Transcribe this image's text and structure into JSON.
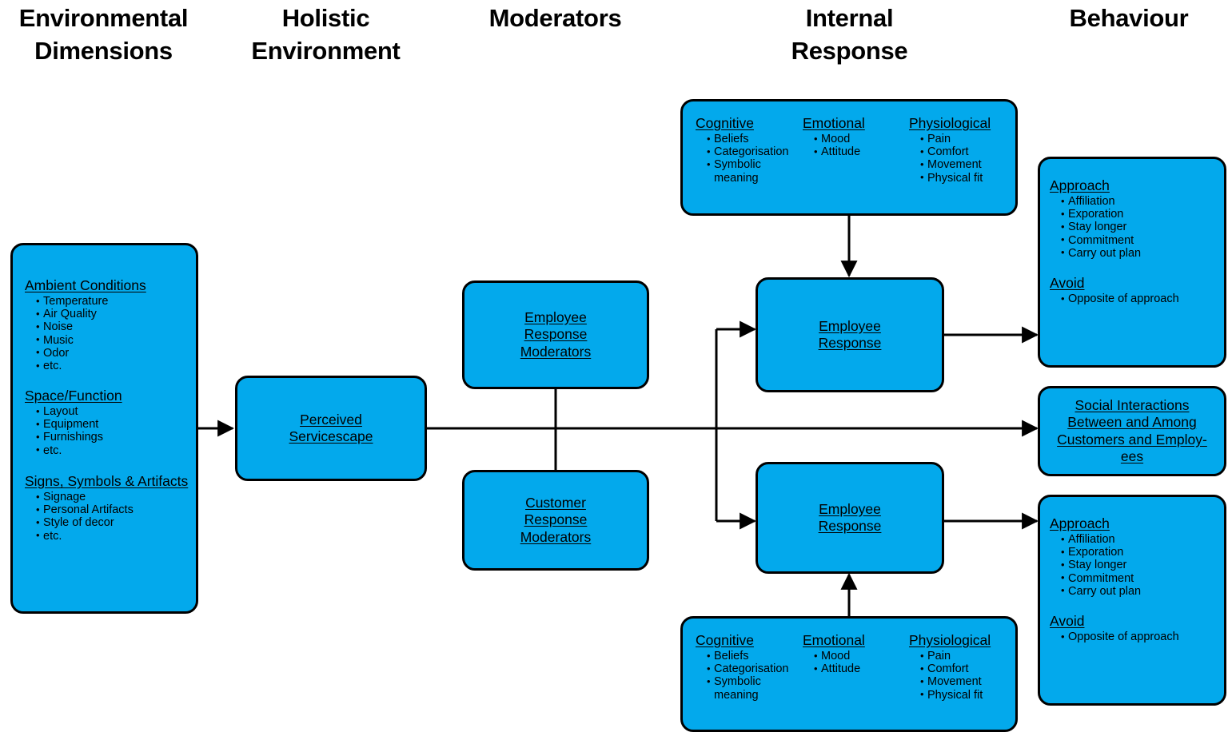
{
  "headers": [
    {
      "label": "Environmental\nDimensions"
    },
    {
      "label": "Holistic\nEnvironment"
    },
    {
      "label": "Moderators"
    },
    {
      "label": "Internal\nResponse"
    },
    {
      "label": "Behaviour"
    }
  ],
  "colors": {
    "box_fill": "#03a9ec",
    "box_stroke": "#000000",
    "text": "#000000",
    "background": "#ffffff"
  },
  "environmental_dimensions": {
    "groups": [
      {
        "title": "Ambient Conditions",
        "items": [
          "Temperature",
          "Air Quality",
          "Noise",
          "Music",
          "Odor",
          "etc."
        ]
      },
      {
        "title": "Space/Function",
        "items": [
          "Layout",
          "Equipment",
          "Furnishings",
          "etc."
        ]
      },
      {
        "title": "Signs, Symbols & Artifacts",
        "items": [
          "Signage",
          "Personal Artifacts",
          "Style of decor",
          "etc."
        ]
      }
    ]
  },
  "holistic_environment": {
    "perceived_servicescape": {
      "lines": [
        "Perceived",
        "Servicescape"
      ]
    }
  },
  "moderators": {
    "employee_response_moderators": {
      "lines": [
        "Employee",
        "Response",
        "Moderators"
      ]
    },
    "customer_response_moderators": {
      "lines": [
        "Customer",
        "Response",
        "Moderators"
      ]
    }
  },
  "internal_response": {
    "top_panel": {
      "groups": [
        {
          "title": "Cognitive",
          "items": [
            "Beliefs",
            "Categorisation",
            "Symbolic meaning"
          ]
        },
        {
          "title": "Emotional",
          "items": [
            "Mood",
            "Attitude"
          ]
        },
        {
          "title": "Physiological",
          "items": [
            "Pain",
            "Comfort",
            "Movement",
            "Physical fit"
          ]
        }
      ]
    },
    "bottom_panel": {
      "groups": [
        {
          "title": "Cognitive",
          "items": [
            "Beliefs",
            "Categorisation",
            "Symbolic meaning"
          ]
        },
        {
          "title": "Emotional",
          "items": [
            "Mood",
            "Attitude"
          ]
        },
        {
          "title": "Physiological",
          "items": [
            "Pain",
            "Comfort",
            "Movement",
            "Physical fit"
          ]
        }
      ]
    },
    "employee_response_top": {
      "lines": [
        "Employee",
        "Response"
      ]
    },
    "employee_response_bottom": {
      "lines": [
        "Employee",
        "Response"
      ]
    }
  },
  "behaviour": {
    "top_box": {
      "groups": [
        {
          "title": "Approach",
          "items": [
            "Affiliation",
            "Exporation",
            "Stay longer",
            "Commitment",
            "Carry out plan"
          ]
        },
        {
          "title": "Avoid",
          "items": [
            "Opposite of approach"
          ]
        }
      ]
    },
    "middle_box": {
      "lines": [
        "Social Interactions",
        "Between and Among",
        "Customers and Employ-",
        "ees"
      ]
    },
    "bottom_box": {
      "groups": [
        {
          "title": "Approach",
          "items": [
            "Affiliation",
            "Exporation",
            "Stay longer",
            "Commitment",
            "Carry out plan"
          ]
        },
        {
          "title": "Avoid",
          "items": [
            "Opposite of approach"
          ]
        }
      ]
    }
  }
}
